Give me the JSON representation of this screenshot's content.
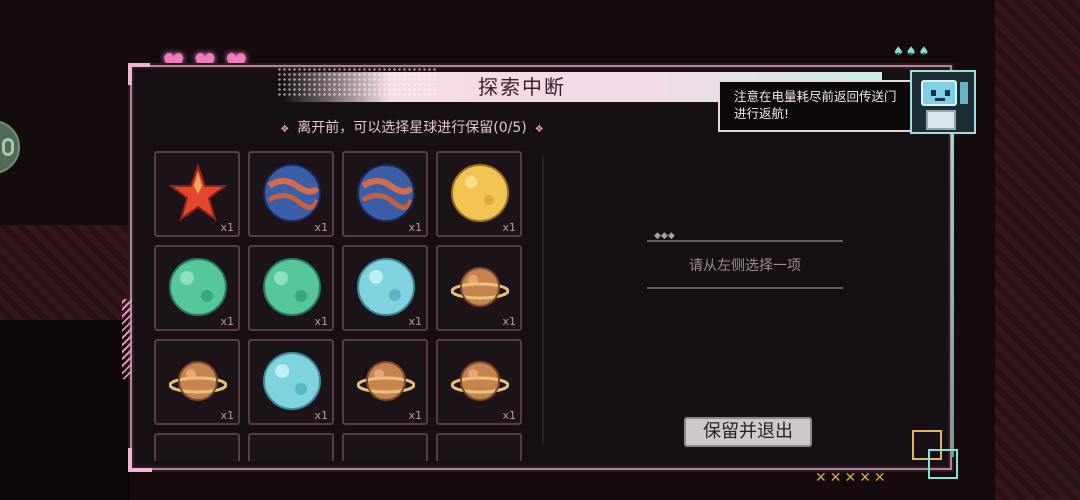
{
  "window": {
    "title": "探索中断",
    "subtitle": "离开前，可以选择星球进行保留(0/5)",
    "subtitle_marks": [
      "❖",
      "❖"
    ]
  },
  "hearts": [
    "♥",
    "♥",
    "♥"
  ],
  "notice": {
    "text": "注意在电量耗尽前返回传送门进行返航!"
  },
  "items": [
    {
      "name": "star",
      "qty": "x1",
      "type": "star"
    },
    {
      "name": "blue-lava-planet",
      "qty": "x1",
      "type": "swirl"
    },
    {
      "name": "blue-lava-planet",
      "qty": "x1",
      "type": "swirl"
    },
    {
      "name": "gold-planet",
      "qty": "x1",
      "type": "gold"
    },
    {
      "name": "green-planet",
      "qty": "x1",
      "type": "green"
    },
    {
      "name": "green-planet",
      "qty": "x1",
      "type": "green"
    },
    {
      "name": "ice-planet",
      "qty": "x1",
      "type": "ice"
    },
    {
      "name": "ringed-planet",
      "qty": "x1",
      "type": "ringed"
    },
    {
      "name": "ringed-planet",
      "qty": "x1",
      "type": "ringed"
    },
    {
      "name": "ice-planet",
      "qty": "x1",
      "type": "ice"
    },
    {
      "name": "ringed-planet",
      "qty": "x1",
      "type": "ringed"
    },
    {
      "name": "ringed-planet",
      "qty": "x1",
      "type": "ringed"
    },
    {
      "name": "partial-item",
      "qty": "",
      "type": "none"
    },
    {
      "name": "partial-item",
      "qty": "",
      "type": "none"
    },
    {
      "name": "partial-item",
      "qty": "",
      "type": "none"
    },
    {
      "name": "partial-item",
      "qty": "",
      "type": "none"
    }
  ],
  "detail": {
    "empty_text": "请从左侧选择一项",
    "deco": "◆◆◆"
  },
  "actions": {
    "save_exit_label": "保留并退出"
  },
  "decor": {
    "small_hearts": "♠♠♠",
    "x_marks": "✕✕✕✕✕"
  },
  "colors": {
    "accent_pink": "#f07bbf",
    "accent_teal": "#7fe6d5",
    "panel_bg": "#161015"
  }
}
